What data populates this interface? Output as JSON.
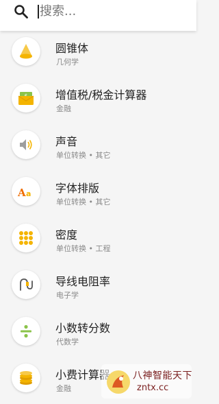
{
  "search": {
    "placeholder": "搜索..."
  },
  "items": [
    {
      "icon": "cone-icon",
      "title": "圆锥体",
      "subtitle": "几何学"
    },
    {
      "icon": "money-envelope-icon",
      "title": "增值税/税金计算器",
      "subtitle": "金融"
    },
    {
      "icon": "speaker-icon",
      "title": "声音",
      "subtitle": "单位转换 • 其它"
    },
    {
      "icon": "font-icon",
      "title": "字体排版",
      "subtitle": "单位转换 • 其它"
    },
    {
      "icon": "density-dots-icon",
      "title": "密度",
      "subtitle": "单位转换 • 工程"
    },
    {
      "icon": "wire-icon",
      "title": "导线电阻率",
      "subtitle": "电子学"
    },
    {
      "icon": "divide-icon",
      "title": "小数转分数",
      "subtitle": "代数学"
    },
    {
      "icon": "coins-icon",
      "title": "小费计算器",
      "subtitle": "金融"
    }
  ],
  "watermark": {
    "text": "八神智能天下",
    "url": "zntx.cc"
  },
  "colors": {
    "accent": "#f4b400",
    "background": "#f5f5f5"
  }
}
